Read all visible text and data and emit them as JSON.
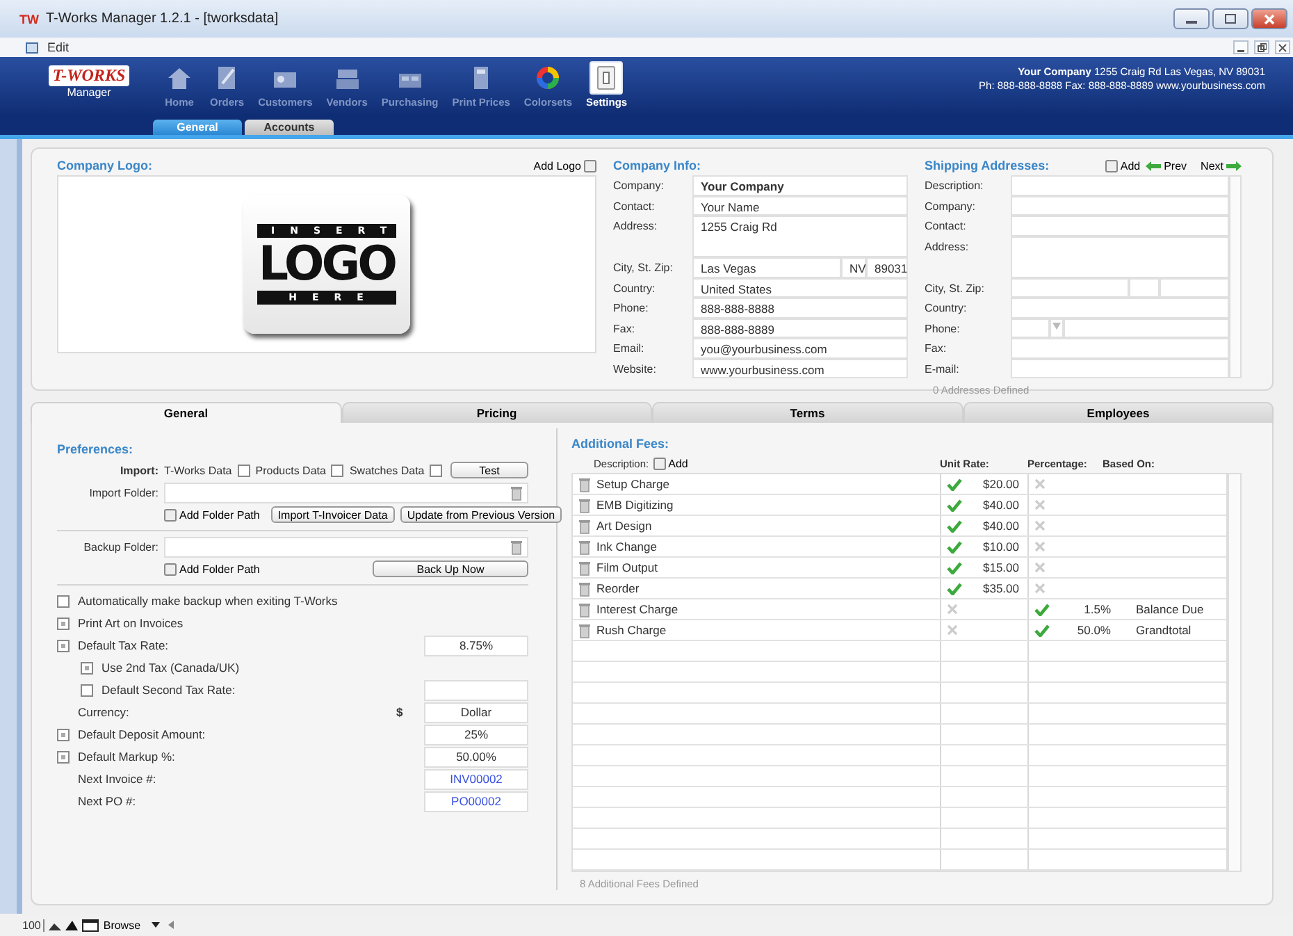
{
  "window": {
    "badge": "TW",
    "title": "T-Works Manager 1.2.1 - [tworksdata]"
  },
  "menu": [
    {
      "label": "Edit"
    }
  ],
  "header": {
    "logo": "T-WORKS",
    "logo_sub": "Manager",
    "nav": [
      {
        "label": "Home",
        "selected": false
      },
      {
        "label": "Orders",
        "selected": false
      },
      {
        "label": "Customers",
        "selected": false
      },
      {
        "label": "Vendors",
        "selected": false
      },
      {
        "label": "Purchasing",
        "selected": false
      },
      {
        "label": "Print Prices",
        "selected": false
      },
      {
        "label": "Colorsets",
        "selected": false
      },
      {
        "label": "Settings",
        "selected": true
      }
    ],
    "company_lines": [
      "**Your Company** 1255 Craig Rd Las Vegas, NV 89031",
      "Ph: 888-888-8888 Fax: 888-888-8889 www.yourbusiness.com"
    ]
  },
  "subtabs": [
    {
      "label": "General",
      "selected": true
    },
    {
      "label": "Accounts",
      "selected": false
    }
  ],
  "company_logo": {
    "title": "Company Logo:",
    "add": "Add Logo",
    "placeholder": [
      "INSERT",
      "LOGO",
      "HERE"
    ]
  },
  "company_info": {
    "title": "Company Info:",
    "fields": [
      {
        "label": "Company:",
        "kind": "bold",
        "value": "Your Company"
      },
      {
        "label": "Contact:",
        "kind": "text",
        "value": "Your Name"
      },
      {
        "label": "Address:",
        "kind": "tall",
        "value": "1255 Craig Rd"
      },
      {
        "label": "City, St. Zip:",
        "kind": "city",
        "values": [
          "Las Vegas",
          "NV",
          "89031"
        ]
      },
      {
        "label": "Country:",
        "kind": "text",
        "value": "United States"
      },
      {
        "label": "Phone:",
        "kind": "text",
        "value": "888-888-8888"
      },
      {
        "label": "Fax:",
        "kind": "text",
        "value": "888-888-8889"
      },
      {
        "label": "Email:",
        "kind": "text",
        "value": "you@yourbusiness.com"
      },
      {
        "label": "Website:",
        "kind": "text",
        "value": "www.yourbusiness.com"
      }
    ]
  },
  "shipping": {
    "title": "Shipping Addresses:",
    "add": "Add",
    "prev": "Prev",
    "next": "Next",
    "fields": [
      {
        "label": "Description:",
        "kind": "text"
      },
      {
        "label": "Company:",
        "kind": "text"
      },
      {
        "label": "Contact:",
        "kind": "text"
      },
      {
        "label": "Address:",
        "kind": "tall"
      },
      {
        "label": "City, St. Zip:",
        "kind": "city"
      },
      {
        "label": "Country:",
        "kind": "text"
      },
      {
        "label": "Phone:",
        "kind": "phone"
      },
      {
        "label": "Fax:",
        "kind": "text"
      },
      {
        "label": "E-mail:",
        "kind": "text"
      }
    ],
    "footer": "0 Addresses Defined"
  },
  "tabs": [
    {
      "label": "General",
      "selected": true
    },
    {
      "label": "Pricing",
      "selected": false
    },
    {
      "label": "Terms",
      "selected": false
    },
    {
      "label": "Employees",
      "selected": false
    }
  ],
  "preferences": {
    "title": "Preferences:",
    "import": {
      "label": "Import:",
      "options": [
        {
          "label": "T-Works Data",
          "checked": false
        },
        {
          "label": "Products Data",
          "checked": false
        },
        {
          "label": "Swatches Data",
          "checked": false
        }
      ],
      "button": "Test"
    },
    "folders": [
      {
        "label": "Import Folder:",
        "add": "Add Folder Path",
        "buttons": [
          "Import T-Invoicer Data",
          "Update from Previous Version"
        ]
      },
      {
        "label": "Backup Folder:",
        "add": "Add Folder Path",
        "buttons": [
          "Back Up Now"
        ]
      }
    ],
    "settings": [
      {
        "kind": "check",
        "label": "Automatically make backup when exiting T-Works",
        "checked": false
      },
      {
        "kind": "check",
        "label": "Print Art on Invoices",
        "checked": true
      },
      {
        "kind": "check_field",
        "label": "Default Tax Rate:",
        "checked": true,
        "value": "8.75%",
        "children": [
          {
            "kind": "check",
            "label": "Use 2nd Tax (Canada/UK)",
            "checked": true
          },
          {
            "kind": "check_field",
            "label": "Default Second Tax Rate:",
            "checked": false
          }
        ]
      },
      {
        "kind": "field",
        "label": "Currency:",
        "symbol": "$",
        "value": "Dollar"
      },
      {
        "kind": "check_field",
        "label": "Default Deposit Amount:",
        "checked": true,
        "value": "25%"
      },
      {
        "kind": "check_field",
        "label": "Default Markup %:",
        "checked": true,
        "value": "50.00%"
      },
      {
        "kind": "number_field",
        "label": "Next Invoice #:",
        "value": "INV00002"
      },
      {
        "kind": "number_field",
        "label": "Next PO #:",
        "value": "PO00002"
      }
    ]
  },
  "fees": {
    "title": "Additional Fees:",
    "description_label": "Description:",
    "add": "Add",
    "columns": [
      "Unit Rate:",
      "Percentage:",
      "Based On:"
    ],
    "rows": [
      {
        "description": "Setup Charge",
        "unit_rate_on": true,
        "unit_rate": "$20.00",
        "percentage_on": false
      },
      {
        "description": "EMB Digitizing",
        "unit_rate_on": true,
        "unit_rate": "$40.00",
        "percentage_on": false
      },
      {
        "description": "Art Design",
        "unit_rate_on": true,
        "unit_rate": "$40.00",
        "percentage_on": false
      },
      {
        "description": "Ink Change",
        "unit_rate_on": true,
        "unit_rate": "$10.00",
        "percentage_on": false
      },
      {
        "description": "Film Output",
        "unit_rate_on": true,
        "unit_rate": "$15.00",
        "percentage_on": false
      },
      {
        "description": "Reorder",
        "unit_rate_on": true,
        "unit_rate": "$35.00",
        "percentage_on": false
      },
      {
        "description": "Interest Charge",
        "unit_rate_on": false,
        "percentage_on": true,
        "percentage": "1.5%",
        "based_on": "Balance Due"
      },
      {
        "description": "Rush Charge",
        "unit_rate_on": false,
        "percentage_on": true,
        "percentage": "50.0%",
        "based_on": "Grandtotal"
      }
    ],
    "footer": "8 Additional Fees Defined"
  },
  "status_bar": {
    "zoom": "100",
    "mode": "Browse"
  }
}
